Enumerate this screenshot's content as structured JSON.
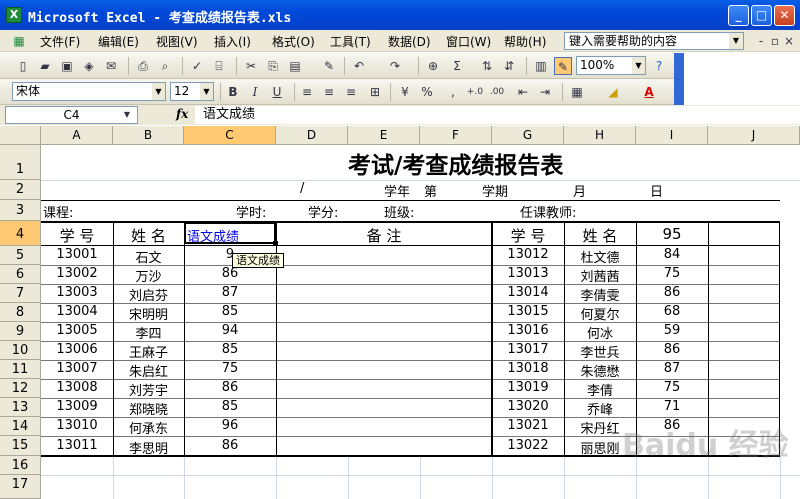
{
  "window": {
    "title": "Microsoft Excel - 考查成绩报告表.xls",
    "app_icon": "X"
  },
  "menu": {
    "items": [
      "文件(F)",
      "编辑(E)",
      "视图(V)",
      "插入(I)",
      "格式(O)",
      "工具(T)",
      "数据(D)",
      "窗口(W)",
      "帮助(H)"
    ],
    "help_placeholder": "键入需要帮助的内容"
  },
  "toolbar": {
    "zoom": "100%",
    "font": "宋体",
    "font_size": "12"
  },
  "formula_bar": {
    "name_box": "C4",
    "fx": "fx",
    "content": "语文成绩"
  },
  "columns": [
    "A",
    "B",
    "C",
    "D",
    "E",
    "F",
    "G",
    "H",
    "I",
    "J"
  ],
  "rows": [
    "1",
    "2",
    "3",
    "4",
    "5",
    "6",
    "7",
    "8",
    "9",
    "10",
    "11",
    "12",
    "13",
    "14",
    "15",
    "16",
    "17"
  ],
  "sheet": {
    "title": "考试/考查成绩报告表",
    "row2": {
      "slash": "/",
      "year": "学年",
      "term": "第",
      "period": "学期",
      "month": "月",
      "day": "日"
    },
    "row3": {
      "course": "课程:",
      "hours": "学时:",
      "credits": "学分:",
      "class": "班级:",
      "teacher": "任课教师:"
    },
    "header": {
      "id": "学 号",
      "name": "姓 名",
      "score": "语文成绩",
      "note": "备 注",
      "id2": "学 号",
      "name2": "姓 名",
      "score2": "95"
    },
    "left_rows": [
      {
        "id": "13001",
        "name": "石文",
        "score": "9"
      },
      {
        "id": "13002",
        "name": "万沙",
        "score": "86"
      },
      {
        "id": "13003",
        "name": "刘启芬",
        "score": "87"
      },
      {
        "id": "13004",
        "name": "宋明明",
        "score": "85"
      },
      {
        "id": "13005",
        "name": "李四",
        "score": "94"
      },
      {
        "id": "13006",
        "name": "王麻子",
        "score": "85"
      },
      {
        "id": "13007",
        "name": "朱启红",
        "score": "75"
      },
      {
        "id": "13008",
        "name": "刘芳宇",
        "score": "86"
      },
      {
        "id": "13009",
        "name": "郑晓晓",
        "score": "85"
      },
      {
        "id": "13010",
        "name": "何承东",
        "score": "96"
      },
      {
        "id": "13011",
        "name": "李思明",
        "score": "86"
      }
    ],
    "right_rows": [
      {
        "id": "13012",
        "name": "杜文德",
        "score": "84"
      },
      {
        "id": "13013",
        "name": "刘茜茜",
        "score": "75"
      },
      {
        "id": "13014",
        "name": "李倩雯",
        "score": "86"
      },
      {
        "id": "13015",
        "name": "何夏尔",
        "score": "68"
      },
      {
        "id": "13016",
        "name": "何冰",
        "score": "59"
      },
      {
        "id": "13017",
        "name": "李世兵",
        "score": "86"
      },
      {
        "id": "13018",
        "name": "朱德懋",
        "score": "87"
      },
      {
        "id": "13019",
        "name": "李倩",
        "score": "75"
      },
      {
        "id": "13020",
        "name": "乔峰",
        "score": "71"
      },
      {
        "id": "13021",
        "name": "宋丹红",
        "score": "86"
      },
      {
        "id": "13022",
        "name": "丽思刚",
        "score": ""
      }
    ]
  },
  "tooltip": "语文成绩",
  "watermark": "Baidu 经验",
  "colors": {
    "title_bar": "#0048d8",
    "selected_header": "#ffc873",
    "menu_bg": "#ece9d8"
  }
}
